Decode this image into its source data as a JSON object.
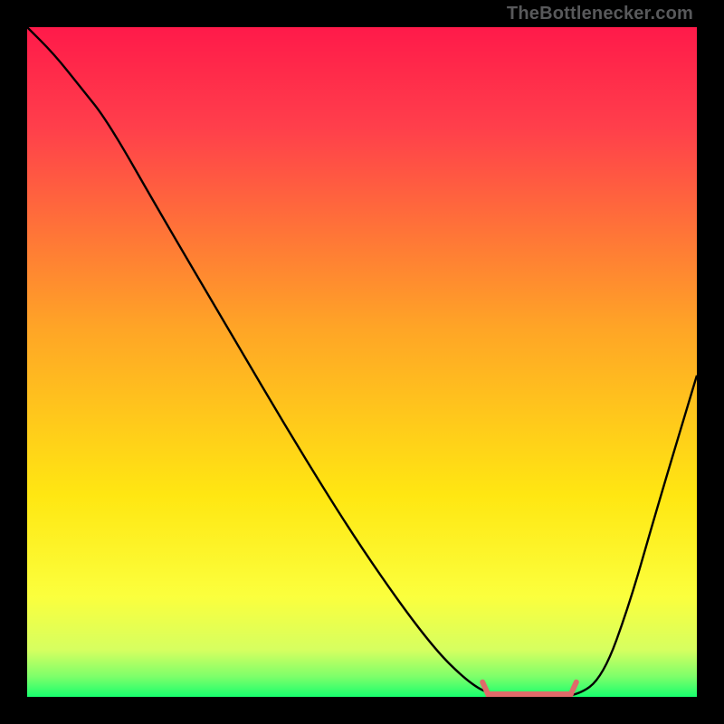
{
  "watermark": "TheBottlenecker.com",
  "chart_data": {
    "type": "line",
    "title": "",
    "xlabel": "",
    "ylabel": "",
    "xlim": [
      0,
      100
    ],
    "ylim": [
      0,
      100
    ],
    "gradient_stops": [
      {
        "offset": 0.0,
        "color": "#ff1a4a"
      },
      {
        "offset": 0.15,
        "color": "#ff3f4b"
      },
      {
        "offset": 0.45,
        "color": "#ffa526"
      },
      {
        "offset": 0.7,
        "color": "#ffe712"
      },
      {
        "offset": 0.85,
        "color": "#fbff3d"
      },
      {
        "offset": 0.93,
        "color": "#d6ff60"
      },
      {
        "offset": 0.97,
        "color": "#7dff6a"
      },
      {
        "offset": 1.0,
        "color": "#18ff6e"
      }
    ],
    "series": [
      {
        "name": "curve",
        "color": "#000000",
        "x": [
          0,
          4,
          8,
          12,
          20,
          30,
          40,
          50,
          60,
          66,
          70,
          76,
          82,
          86,
          90,
          94,
          100
        ],
        "y": [
          100,
          96,
          91,
          86,
          72,
          55,
          38,
          22,
          8,
          2,
          0,
          0,
          0,
          3,
          14,
          28,
          48
        ]
      }
    ],
    "flat_segment": {
      "color": "#e06a6a",
      "x0": 68,
      "x1": 82,
      "y": 0.4,
      "end_bump": 1.8
    }
  }
}
